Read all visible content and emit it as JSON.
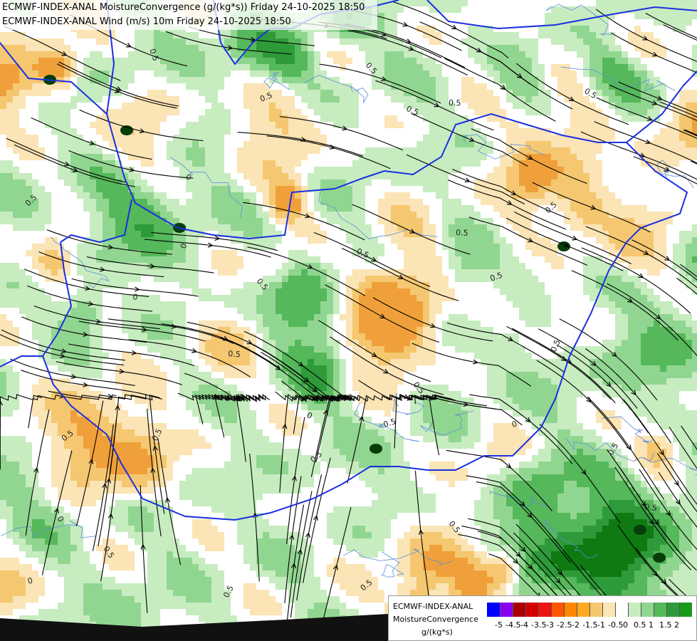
{
  "titles": [
    "ECMWF-INDEX-ANAL MoistureConvergence (g/(kg*s)) Friday 24-10-2025 18:50",
    "ECMWF-INDEX-ANAL Wind (m/s) 10m Friday 24-10-2025 18:50"
  ],
  "map_labels": [
    "0",
    "0.5",
    "-0.5"
  ],
  "legend": {
    "name_line1": "ECMWF-INDEX-ANAL",
    "name_line2": "MoistureConvergence",
    "unit": "g/(kg*s)",
    "colors": [
      "#0000ff",
      "#8800ee",
      "#aa0000",
      "#d10000",
      "#ee1111",
      "#ff5500",
      "#ff8800",
      "#ffaa22",
      "#f5c770",
      "#fbe4b5",
      "#ffffff",
      "#c7ecc0",
      "#91d690",
      "#55b85a",
      "#2e9a3a",
      "#1a9a1a"
    ],
    "ticks": [
      "-5",
      "-4.5",
      "-4",
      "-3.5",
      "-3",
      "-2.5",
      "-2",
      "-1.5",
      "-1",
      "-0.5",
      "0",
      "0.5",
      "1",
      "1.5",
      "2"
    ]
  },
  "colors": {
    "border": "#1a2fe0",
    "river": "#5b8fd6",
    "streamline": "#000000"
  }
}
